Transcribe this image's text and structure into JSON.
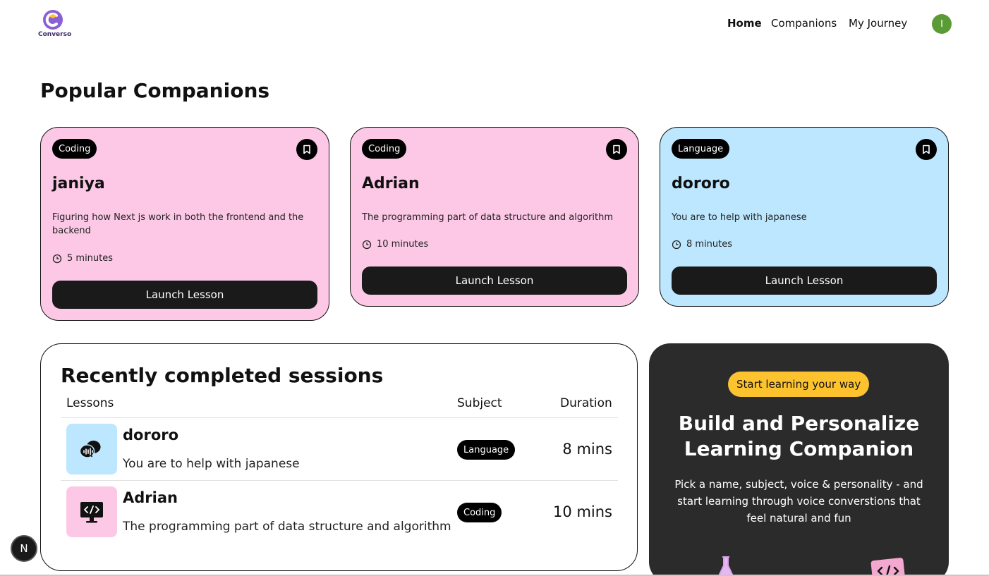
{
  "nav": {
    "logo_text": "Converso",
    "links": [
      "Home",
      "Companions",
      "My Journey"
    ],
    "active": "Home",
    "avatar_initial": "I"
  },
  "popular": {
    "title": "Popular Companions",
    "cards": [
      {
        "subject": "Coding",
        "name": "janiya",
        "topic": "Figuring how Next js work in both the frontend and the backend",
        "duration": "5 minutes",
        "button": "Launch Lesson",
        "color": "#fcc8e6"
      },
      {
        "subject": "Coding",
        "name": "Adrian",
        "topic": "The programming part of data structure and algorithm",
        "duration": "10 minutes",
        "button": "Launch Lesson",
        "color": "#fcc8e6"
      },
      {
        "subject": "Language",
        "name": "dororo",
        "topic": "You are to help with japanese",
        "duration": "8 minutes",
        "button": "Launch Lesson",
        "color": "#bde7ff"
      }
    ]
  },
  "recent": {
    "title": "Recently completed sessions",
    "headers": [
      "Lessons",
      "Subject",
      "Duration"
    ],
    "rows": [
      {
        "name": "dororo",
        "topic": "You are to help with japanese",
        "subject": "Language",
        "duration": "8 mins",
        "icon": "language-icon",
        "color": "#bde7ff"
      },
      {
        "name": "Adrian",
        "topic": "The programming part of data structure and algorithm",
        "subject": "Coding",
        "duration": "10 mins",
        "icon": "coding-icon",
        "color": "#fcc8e6"
      }
    ]
  },
  "cta": {
    "pill": "Start learning your way",
    "title_line1": "Build and Personalize",
    "title_line2": "Learning Companion",
    "body": "Pick a name, subject, voice & personality - and start learning through voice converstions that feel natural and fun"
  },
  "dev_badge": "N",
  "colors": {
    "pink": "#fcc8e6",
    "blue": "#bde7ff",
    "yellow": "#fcc32f",
    "dark": "#2b2b2b",
    "avatar": "#5b9b36"
  }
}
